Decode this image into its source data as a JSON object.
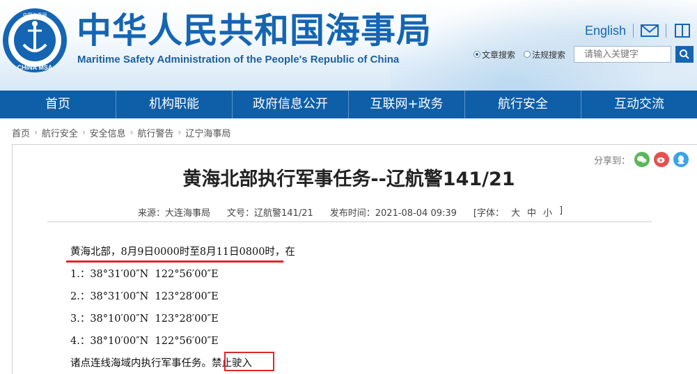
{
  "header": {
    "title": "中华人民共和国海事局",
    "subtitle": "Maritime Safety Administration of the People's Republic of China",
    "logo": {
      "top_text": "中国海事局",
      "bottom_text": "CHINA MSA"
    },
    "lang_link": "English",
    "search": {
      "options": [
        {
          "label": "文章搜索",
          "selected": true
        },
        {
          "label": "法规搜索",
          "selected": false
        }
      ],
      "placeholder": "请输入关键字"
    }
  },
  "nav": {
    "items": [
      "首页",
      "机构职能",
      "政府信息公开",
      "互联网+政务",
      "航行安全",
      "互动交流"
    ]
  },
  "breadcrumb": [
    "首页",
    "航行安全",
    "安全信息",
    "航行警告",
    "辽宁海事局"
  ],
  "share": {
    "label": "分享到："
  },
  "article": {
    "title": "黄海北部执行军事任务--辽航警141/21",
    "source": "来源：大连海事局",
    "doc_no": "文号：辽航警141/21",
    "publish_time": "发布时间：2021-08-04 09:39",
    "font_label": "[字体：",
    "font_sizes": [
      "大",
      "中",
      "小"
    ],
    "font_close": "]",
    "lines": [
      "黄海北部，8月9日0000时至8月11日0800时，在",
      "1.：38°31′00″N  122°56′00″E",
      "2.：38°31′00″N  123°28′00″E",
      "3.：38°10′00″N  123°28′00″E",
      "4.：38°10′00″N  122°56′00″E"
    ],
    "last_line_prefix": "诸点连线海域内执行军事任务。",
    "last_line_highlight": "禁止驶入"
  },
  "colors": {
    "brand_blue": "#1565b3",
    "nav_bg": "#0f5ea8",
    "highlight_red": "#e0262c"
  }
}
